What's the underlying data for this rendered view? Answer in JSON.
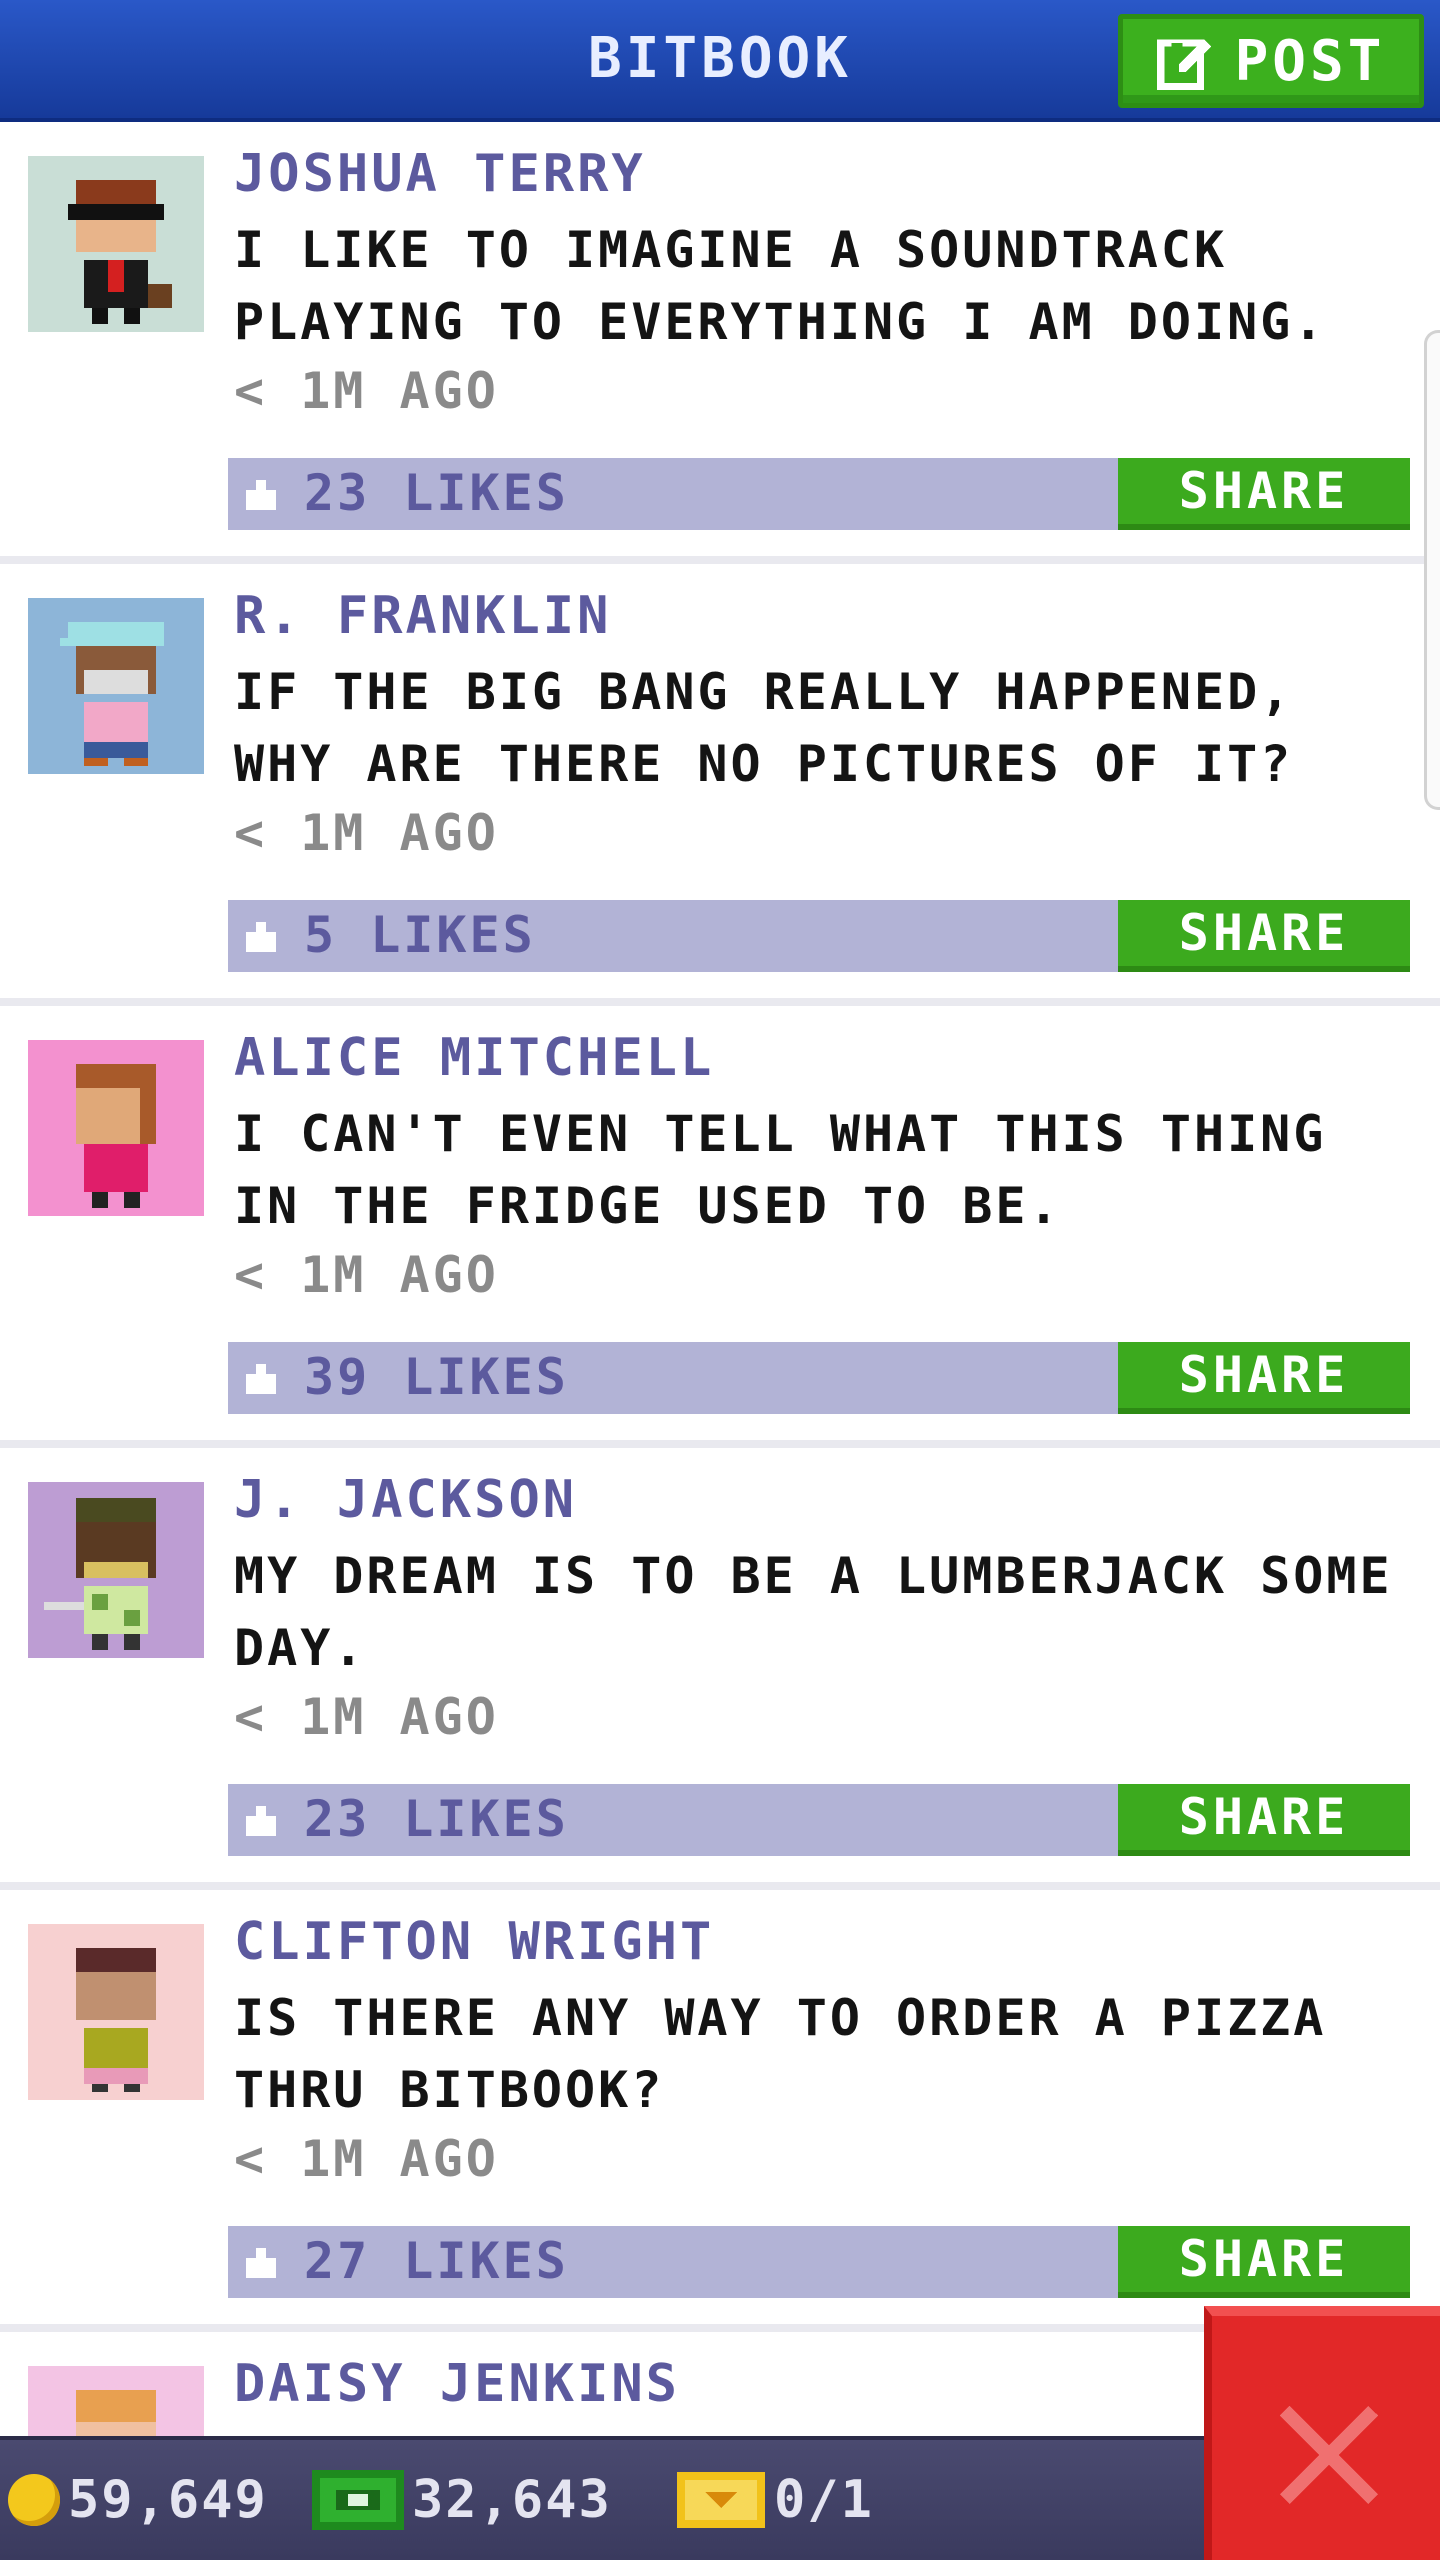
{
  "header": {
    "title": "BITBOOK",
    "post_label": "POST"
  },
  "posts": [
    {
      "author": "JOSHUA TERRY",
      "message": "I LIKE TO IMAGINE A SOUNDTRACK PLAYING TO EVERYTHING I AM DOING.",
      "time": "< 1M AGO",
      "likes": "23 LIKES",
      "share": "SHARE",
      "avatar_bg": "#c9ded6"
    },
    {
      "author": "R. FRANKLIN",
      "message": "IF THE BIG BANG REALLY HAPPENED, WHY ARE THERE NO PICTURES OF IT?",
      "time": "< 1M AGO",
      "likes": "5 LIKES",
      "share": "SHARE",
      "avatar_bg": "#8db5d8"
    },
    {
      "author": "ALICE MITCHELL",
      "message": "I CAN'T EVEN TELL WHAT THIS THING IN THE FRIDGE USED TO BE.",
      "time": "< 1M AGO",
      "likes": "39 LIKES",
      "share": "SHARE",
      "avatar_bg": "#f391cf"
    },
    {
      "author": "J. JACKSON",
      "message": "MY DREAM IS TO BE A LUMBERJACK SOME DAY.",
      "time": "< 1M AGO",
      "likes": "23 LIKES",
      "share": "SHARE",
      "avatar_bg": "#bd9dd3"
    },
    {
      "author": "CLIFTON WRIGHT",
      "message": "IS THERE ANY WAY TO ORDER A PIZZA THRU BITBOOK?",
      "time": "< 1M AGO",
      "likes": "27 LIKES",
      "share": "SHARE",
      "avatar_bg": "#f7d0d0"
    },
    {
      "author": "DAISY JENKINS",
      "avatar_bg": "#f3c4e4"
    }
  ],
  "status": {
    "coins": "59,649",
    "cash": "32,643",
    "tickets": "0/1"
  },
  "colors": {
    "header_blue": "#1f47b0",
    "accent_green": "#3caa1e",
    "likes_bar": "#b2b3d6",
    "author_purple": "#5c5a9e",
    "close_red": "#e22828"
  },
  "icons": [
    "edit-icon",
    "like-icon",
    "coin-icon",
    "cash-icon",
    "ticket-icon",
    "close-icon"
  ]
}
